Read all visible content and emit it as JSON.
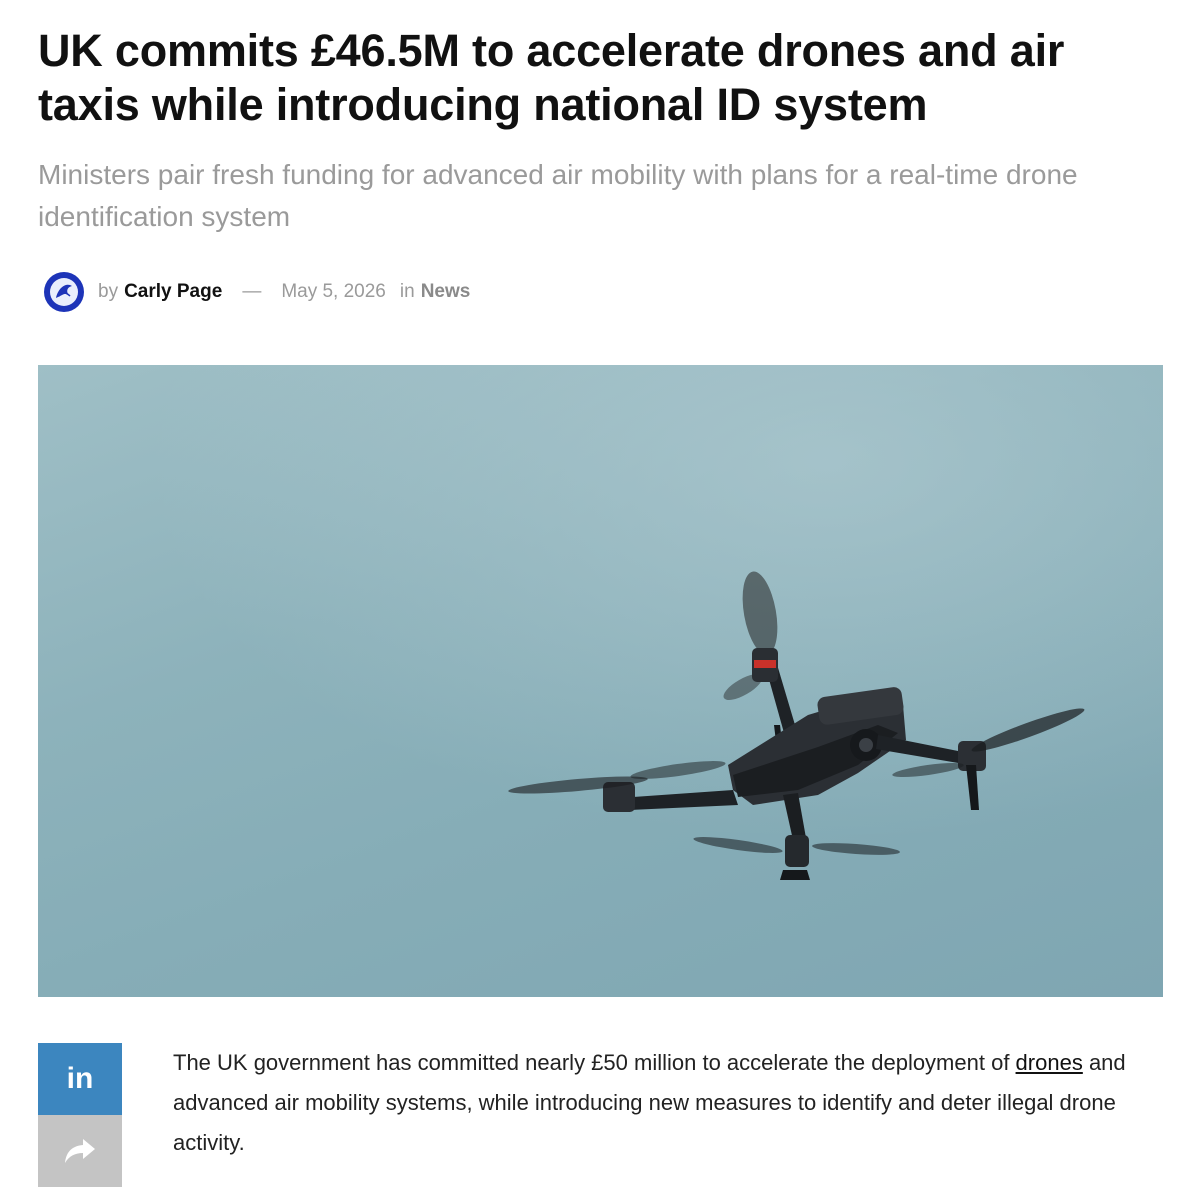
{
  "article": {
    "headline": "UK commits £46.5M to accelerate drones and air taxis while introducing national ID system",
    "subtitle": "Ministers pair fresh funding for advanced air mobility with plans for a real-time drone identification system",
    "byline": {
      "by": "by",
      "author": "Carly Page",
      "separator": "—",
      "date": "May 5, 2026",
      "in": "in",
      "category": "News"
    },
    "body": {
      "part1": "The UK government has committed nearly £50 million to accelerate the deployment of ",
      "link_text": "drones",
      "part2": " and advanced air mobility systems, while introducing new measures to identify and deter illegal drone activity."
    }
  },
  "share": {
    "linkedin_label": "in",
    "linkedin_icon": "linkedin-icon",
    "share_icon": "share-forward-icon"
  },
  "colors": {
    "headline": "#111111",
    "subtitle": "#9a9a9a",
    "linkedin_bg": "#3c86bf",
    "share_bg": "#c4c4c4",
    "avatar_bg": "#1d34b8"
  }
}
